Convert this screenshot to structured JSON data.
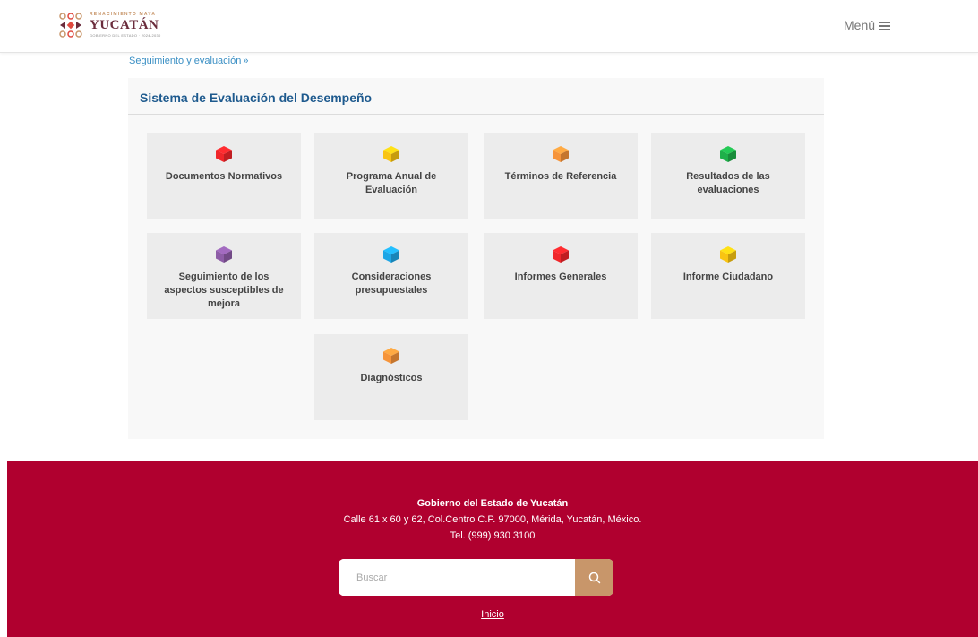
{
  "header": {
    "logo": {
      "top_text": "RENACIMIENTO MAYA",
      "main_text": "YUCATÁN",
      "sub_text": "GOBIERNO DEL ESTADO · 2024-2030"
    },
    "menu_label": "Menú"
  },
  "breadcrumb": {
    "link": "Seguimiento y evaluación",
    "separator": "»"
  },
  "panel": {
    "title": "Sistema de Evaluación del Desempeño"
  },
  "tiles": [
    {
      "label": "Documentos Normativos",
      "color": "#f0262a",
      "icon": "cube-icon"
    },
    {
      "label": "Programa Anual de Evaluación",
      "color": "#f9c412",
      "icon": "cube-icon"
    },
    {
      "label": "Términos de Referencia",
      "color": "#f6943a",
      "icon": "cube-icon"
    },
    {
      "label": "Resultados de las evaluaciones",
      "color": "#1fb04a",
      "icon": "cube-icon"
    },
    {
      "label": "Seguimiento de los aspectos susceptibles de mejora",
      "color": "#8e5da7",
      "icon": "cube-icon"
    },
    {
      "label": "Consideraciones presupuestales",
      "color": "#1ea6e6",
      "icon": "cube-icon"
    },
    {
      "label": "Informes Generales",
      "color": "#f0262a",
      "icon": "cube-icon"
    },
    {
      "label": "Informe Ciudadano",
      "color": "#f9c412",
      "icon": "cube-icon"
    },
    {
      "label": "Diagnósticos",
      "color": "#f6943a",
      "icon": "cube-icon"
    }
  ],
  "footer": {
    "title": "Gobierno del Estado de Yucatán",
    "address": "Calle 61 x 60 y 62, Col.Centro C.P. 97000, Mérida, Yucatán, México.",
    "phone": "Tel. (999) 930 3100",
    "search_placeholder": "Buscar",
    "home_link": "Inicio"
  },
  "colors": {
    "footer_bg": "#b0002f",
    "accent": "#c8966a",
    "title_blue": "#1e5a8e",
    "link_blue": "#3a8fc4"
  }
}
